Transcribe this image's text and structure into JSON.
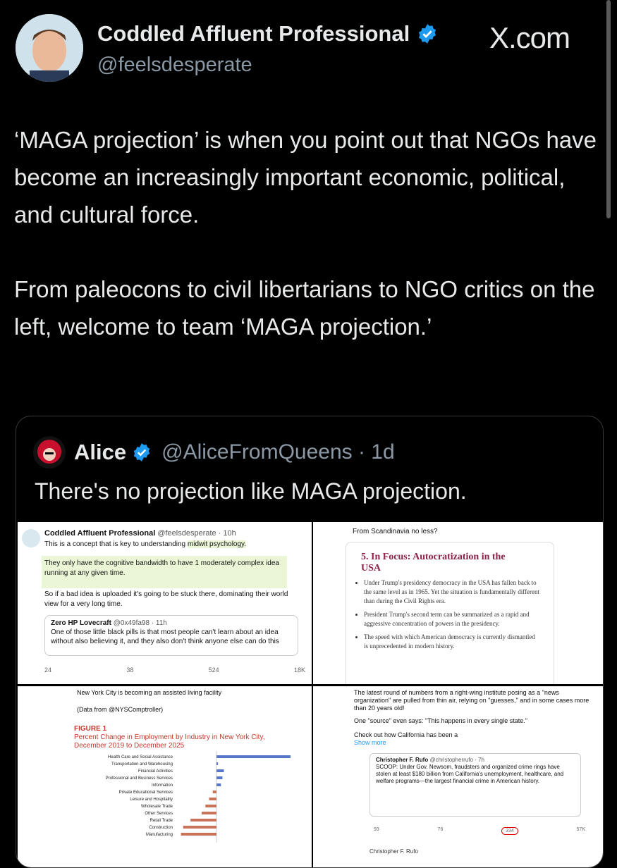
{
  "tweet": {
    "author_name": "Coddled Affluent Professional",
    "author_handle": "@feelsdesperate",
    "site_label": "X.com",
    "text_p1": "‘MAGA projection’ is when you point out that NGOs have become an increasingly important economic, political, and cultural force.",
    "text_p2": "From paleocons to civil libertarians to NGO critics on the left, welcome to team ‘MAGA projection.’"
  },
  "quote": {
    "author_name": "Alice",
    "author_handle": "@AliceFromQueens · 1d",
    "text": "There's no projection like MAGA projection."
  },
  "images": {
    "img1": {
      "name": "Coddled Affluent Professional",
      "handle": "@feelsdesperate · 10h",
      "line1": "This is a concept that is key to understanding ",
      "line1_hl": "midwit psychology.",
      "boxed": "They only have the cognitive bandwidth to have 1 moderately complex idea running at any given time.",
      "line2": "So if a bad idea is uploaded it's going to be stuck there, dominating their world view for a very long time.",
      "q_name": "Zero HP Lovecraft",
      "q_handle": "@0x49fa98 · 11h",
      "q_text": "One of those little black pills is that most people can't learn about an idea without also believing it, and they also don't think anyone else can do this",
      "actions": [
        "24",
        "38",
        "524",
        "18K"
      ]
    },
    "img2": {
      "caption": "From Scandinavia no less?",
      "title": "5. In Focus: Autocratization in the USA",
      "bullets": [
        "Under Trump's presidency democracy in the USA has fallen back to the same level as in 1965. Yet the situation is fundamentally different than during the Civil Rights era.",
        "President Trump's second term can be summarized as a rapid and aggressive concentration of powers in the presidency.",
        "The speed with which American democracy is currently dismantled is unprecedented in modern history."
      ]
    },
    "img3": {
      "line1": "New York City is becoming an assisted living facility",
      "line2": "(Data from @NYSComptroller)",
      "fig_title": "FIGURE 1",
      "fig_sub1": "Percent Change in Employment by Industry in New York City,",
      "fig_sub2": "December 2019 to December 2025",
      "categories": [
        "Health Care and Social Assistance",
        "Transportation and Warehousing",
        "Financial Activities",
        "Professional and Business Services",
        "Information",
        "Private Educational Services",
        "Leisure and Hospitality",
        "Wholesale Trade",
        "Other Services",
        "Retail Trade",
        "Construction",
        "Manufacturing"
      ]
    },
    "img4": {
      "line1": "The latest round of numbers from a right-wing institute posing as a \"news organization\" are pulled from thin air, relying on \"guesses,\" and in some cases more than 20 years old!",
      "line2": "One \"source\" even says: \"This happens in every single state.\"",
      "line3": "Check out how California has been a",
      "show_more": "Show more",
      "q_name": "Christopher F. Rufo",
      "q_handle": "@christopherrufo · 7h",
      "q_text": "SCOOP: Under Gov. Newsom, fraudsters and organized crime rings have stolen at least $180 billion from California's unemployment, healthcare, and welfare programs—the largest financial crime in American history.",
      "actions": [
        "93",
        "76",
        "334",
        "57K"
      ],
      "bottom": "Christopher F. Rufo"
    }
  },
  "colors": {
    "background": "#000000",
    "verified": "#1d9bf0",
    "text": "#e7e9ea",
    "secondary": "#8b98a5"
  }
}
